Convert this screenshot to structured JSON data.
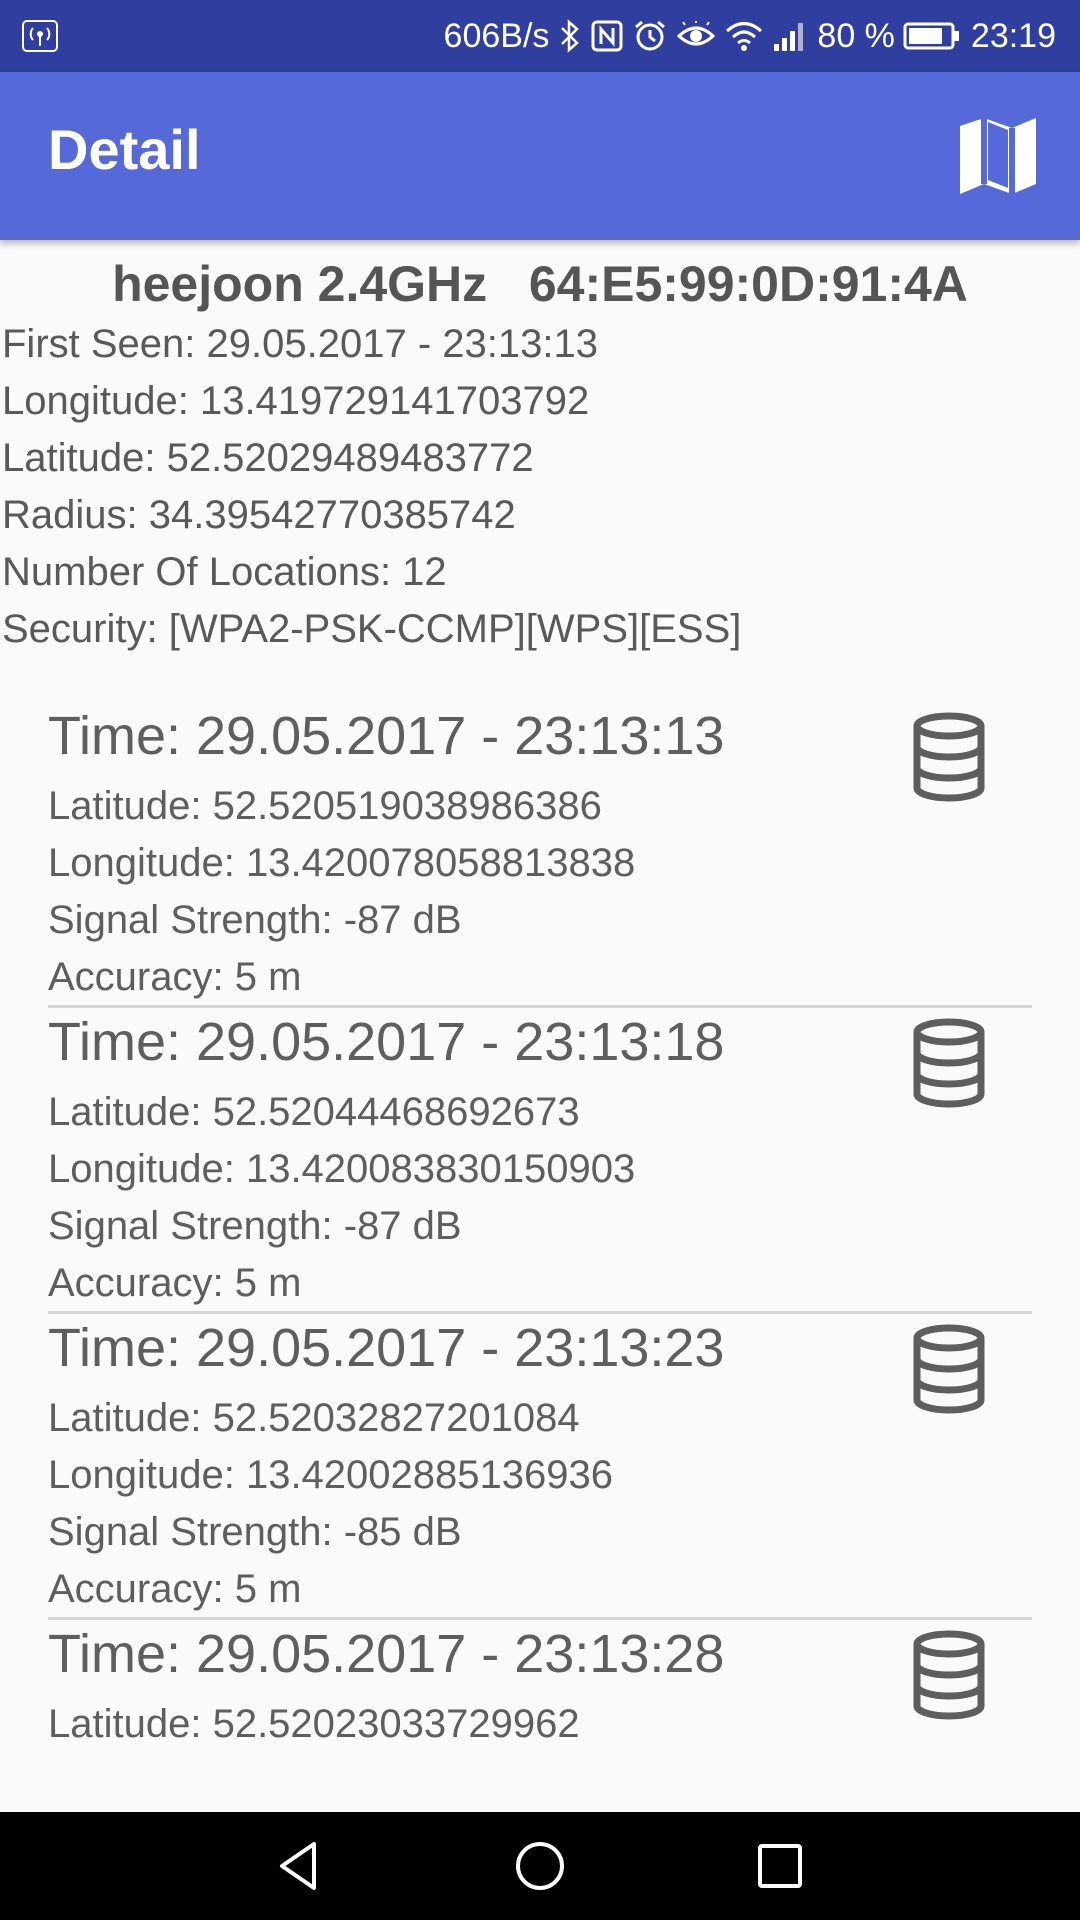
{
  "status_bar": {
    "left_icon": "hotspot-icon",
    "net_speed": "606B/s",
    "icons": [
      "bluetooth-icon",
      "nfc-icon",
      "alarm-icon",
      "eye-icon",
      "wifi-icon",
      "signal-icon"
    ],
    "battery": "80 %",
    "time": "23:19"
  },
  "app_bar": {
    "title": "Detail",
    "map_icon": "map-icon",
    "background": "#5569d8",
    "status_bar_background": "#303f9f"
  },
  "network": {
    "title": "heejoon 2.4GHz   64:E5:99:0D:91:4A",
    "first_seen": "First Seen: 29.05.2017 - 23:13:13",
    "longitude": "Longitude: 13.419729141703792",
    "latitude": "Latitude: 52.52029489483772",
    "radius": "Radius: 34.39542770385742",
    "number_of_locations": "Number Of Locations: 12",
    "security": "Security: [WPA2-PSK-CCMP][WPS][ESS]"
  },
  "locations": [
    {
      "time": "Time: 29.05.2017 - 23:13:13",
      "latitude": "Latitude: 52.520519038986386",
      "longitude": "Longitude: 13.420078058813838",
      "signal": "Signal Strength: -87 dB",
      "accuracy": "Accuracy: 5 m",
      "icon": "database-icon"
    },
    {
      "time": "Time: 29.05.2017 - 23:13:18",
      "latitude": "Latitude: 52.52044468692673",
      "longitude": "Longitude: 13.420083830150903",
      "signal": "Signal Strength: -87 dB",
      "accuracy": "Accuracy: 5 m",
      "icon": "database-icon"
    },
    {
      "time": "Time: 29.05.2017 - 23:13:23",
      "latitude": "Latitude: 52.52032827201084",
      "longitude": "Longitude: 13.42002885136936",
      "signal": "Signal Strength: -85 dB",
      "accuracy": "Accuracy: 5 m",
      "icon": "database-icon"
    },
    {
      "time": "Time: 29.05.2017 - 23:13:28",
      "latitude": "Latitude: 52.52023033729962",
      "longitude": "",
      "signal": "",
      "accuracy": "",
      "icon": "database-icon"
    }
  ],
  "nav_bar": {
    "back_icon": "back-icon",
    "home_icon": "home-icon",
    "recent_icon": "recent-apps-icon"
  }
}
